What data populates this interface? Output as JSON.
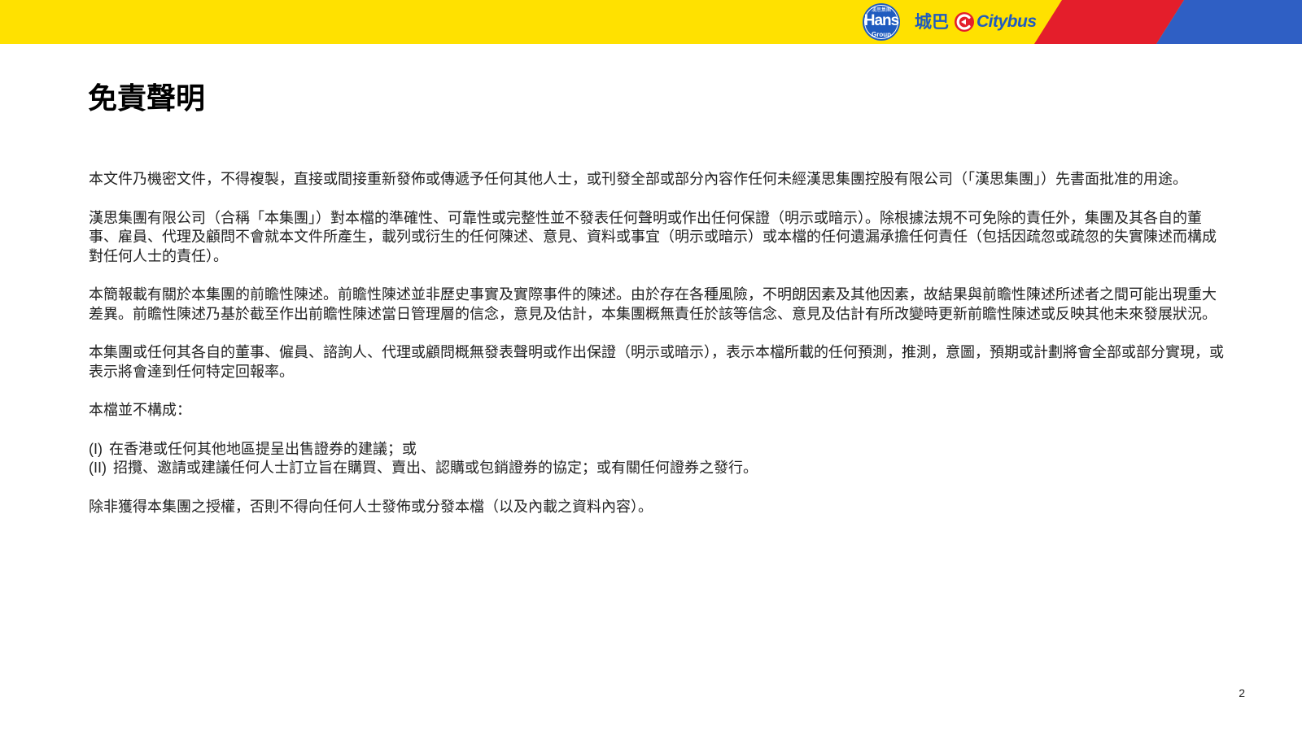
{
  "header": {
    "colors": {
      "yellow": "#FFE100",
      "red": "#E41E2B",
      "blue": "#2F5FC4",
      "logo_blue": "#1F5BBF"
    },
    "hans_logo": {
      "top_text": "漢思集團",
      "word": "Hans",
      "sub": "Group"
    },
    "citybus_chinese": "城巴",
    "citybus_english": "Citybus",
    "citybus_icon": "citybus-c-icon"
  },
  "document": {
    "title": "免責聲明",
    "paragraphs": [
      "本文件乃機密文件，不得複製，直接或間接重新發佈或傳遞予任何其他人士，或刊發全部或部分內容作任何未經漢思集團控股有限公司（「漢思集團」）先書面批准的用途。",
      "漢思集團有限公司（合稱「本集團」）對本檔的準確性、可靠性或完整性並不發表任何聲明或作出任何保證（明示或暗示）。除根據法規不可免除的責任外，集團及其各自的董事、雇員、代理及顧問不會就本文件所產生，載列或衍生的任何陳述、意見、資料或事宜（明示或暗示）或本檔的任何遺漏承擔任何責任（包括因疏忽或疏忽的失實陳述而構成對任何人士的責任）。",
      "本簡報載有關於本集團的前瞻性陳述。前瞻性陳述並非歷史事實及實際事件的陳述。由於存在各種風險，不明朗因素及其他因素，故結果與前瞻性陳述所述者之間可能出現重大差異。前瞻性陳述乃基於截至作出前瞻性陳述當日管理層的信念，意見及估計，本集團概無責任於該等信念、意見及估計有所改變時更新前瞻性陳述或反映其他未來發展狀況。",
      "本集團或任何其各自的董事、僱員、諮詢人、代理或顧問概無發表聲明或作出保證（明示或暗示），表示本檔所載的任何預測，推測，意圖，預期或計劃將會全部或部分實現，或表示將會達到任何特定回報率。",
      "本檔並不構成："
    ],
    "list": [
      {
        "marker": "(I)",
        "text": "在香港或任何其他地區提呈出售證券的建議；或"
      },
      {
        "marker": "(II)",
        "text": "招攬、邀請或建議任何人士訂立旨在購買、賣出、認購或包銷證券的協定；或有關任何證券之發行。"
      }
    ],
    "closing": "除非獲得本集團之授權，否則不得向任何人士發佈或分發本檔（以及內載之資料內容）。",
    "page_number": "2"
  }
}
